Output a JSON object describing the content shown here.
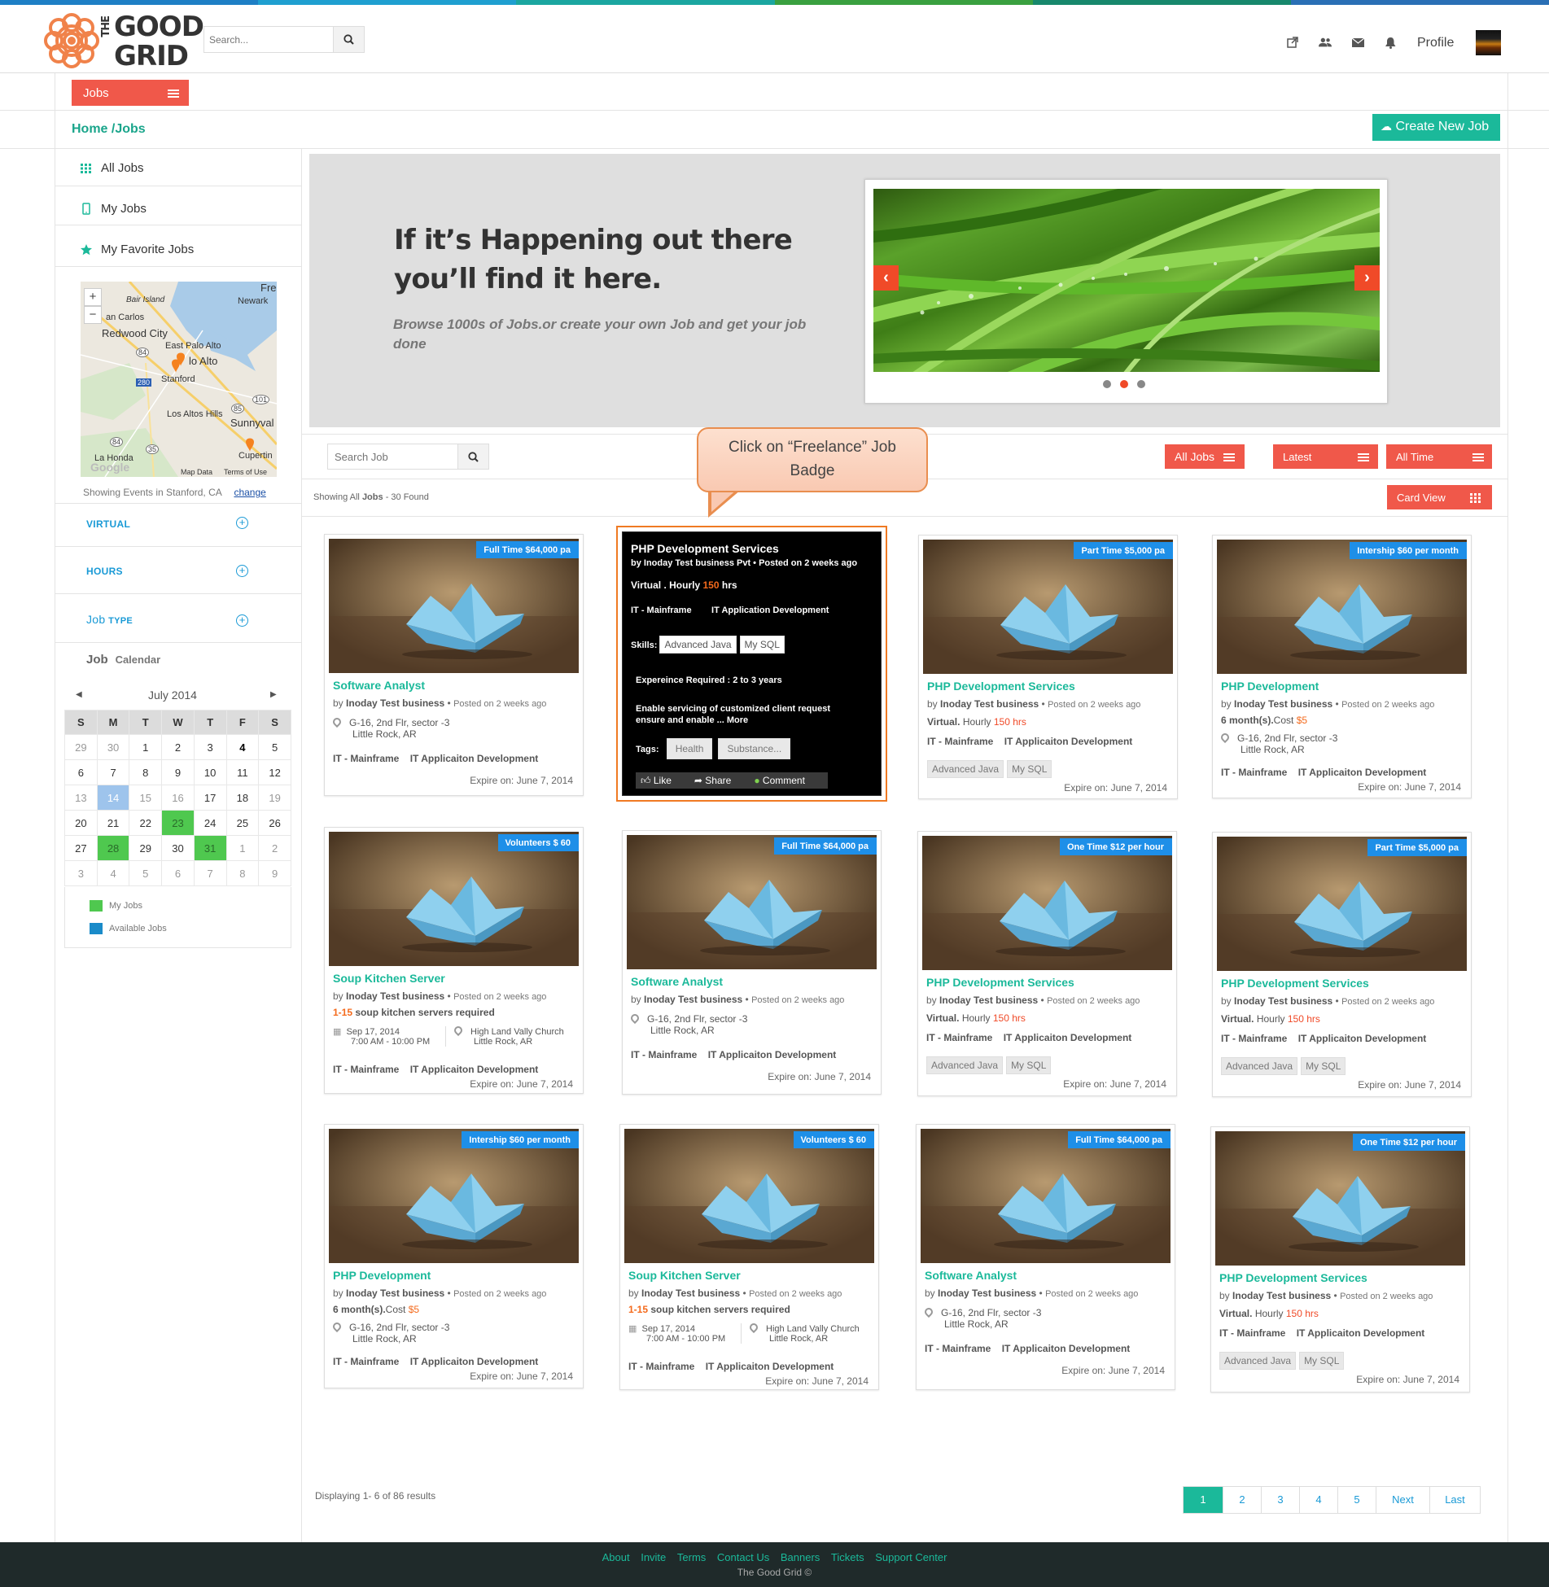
{
  "app": {
    "logo_text_line1": "THE GOOD",
    "logo_text_line2": "GRID",
    "logo_the": "THE",
    "logo_good": "GOOD",
    "search_placeholder": "Search...",
    "profile_label": "Profile",
    "header_icons": [
      "external-link-icon",
      "users-icon",
      "envelope-icon",
      "bell-icon"
    ]
  },
  "colors": {
    "accent": "#1bb99a",
    "primary_red": "#f0584a",
    "badge_blue": "#1e8fe8",
    "link_blue": "#1a9ad6",
    "calendar_green": "#4fc84f",
    "calendar_blue": "#9ec4ec",
    "footer_bg": "#1f2a2a"
  },
  "jobs_menu": {
    "label": "Jobs"
  },
  "breadcrumb": "Home /Jobs",
  "create_button": "Create New Job",
  "sidebar": {
    "items": [
      {
        "label": "All Jobs",
        "icon": "grid-icon"
      },
      {
        "label": "My Jobs",
        "icon": "mobile-icon"
      },
      {
        "label": "My Favorite Jobs",
        "icon": "star-icon"
      }
    ],
    "map": {
      "labels": [
        "Fre",
        "Bair Island",
        "Newark",
        "an Carlos",
        "Redwood City",
        "East Palo Alto",
        "lo Alto",
        "Stanford",
        "Los Altos Hills",
        "Sunnyval",
        "La Honda",
        "Cupertin",
        "Map Data",
        "Terms of Use"
      ],
      "road_labels": [
        "84",
        "280",
        "101",
        "85",
        "84",
        "35"
      ],
      "watermark": "Google",
      "zoom_in": "+",
      "zoom_out": "−"
    },
    "showing_events": "Showing Events in Stanford, CA",
    "change_link": "change",
    "filters": [
      {
        "label": "VIRTUAL"
      },
      {
        "label": "HOURS"
      },
      {
        "label_a": "Job",
        "label_b": "TYPE"
      }
    ],
    "calendar_header_a": "Job",
    "calendar_header_b": "Calendar",
    "calendar": {
      "month": "July 2014",
      "prev": "◀",
      "next": "▶",
      "weekdays": [
        "S",
        "M",
        "T",
        "W",
        "T",
        "F",
        "S"
      ],
      "weeks": [
        [
          "29",
          "30",
          "1",
          "2",
          "3",
          "4",
          "5"
        ],
        [
          "6",
          "7",
          "8",
          "9",
          "10",
          "11",
          "12"
        ],
        [
          "13",
          "14",
          "15",
          "16",
          "17",
          "18",
          "19"
        ],
        [
          "20",
          "21",
          "22",
          "23",
          "24",
          "25",
          "26"
        ],
        [
          "27",
          "28",
          "29",
          "30",
          "31",
          "1",
          "2"
        ],
        [
          "3",
          "4",
          "5",
          "6",
          "7",
          "8",
          "9"
        ]
      ]
    },
    "legend": [
      {
        "label": "My Jobs",
        "color": "#4fc84f"
      },
      {
        "label": "Available Jobs",
        "color": "#1a8bc9"
      }
    ]
  },
  "hero": {
    "headline_1": "If it’s Happening out there",
    "headline_2": "you’ll find it here.",
    "subtext": "Browse 1000s of Jobs.or create your own Job and get your job done"
  },
  "toolbar": {
    "search_placeholder": "Search Job",
    "filters": [
      "All Jobs",
      "Latest",
      "All Time"
    ],
    "view_button": "Card View",
    "showing_prefix": "Showing All",
    "showing_jobs": "Jobs",
    "showing_suffix": "- 30 Found"
  },
  "callout": {
    "line1": "Click on “Freelance” Job",
    "line2": "Badge"
  },
  "common": {
    "business": "Inoday Test business",
    "by": "by",
    "posted": "Posted on 2 weeks ago",
    "address_1": "G-16, 2nd Flr, sector -3",
    "address_2": "Little Rock, AR",
    "church_1": "High Land Vally Church",
    "church_2": "Little Rock, AR",
    "event_date": "Sep 17, 2014",
    "event_time": "7:00 AM - 10:00 PM",
    "cat_1": "IT - Mainframe",
    "cat_2": "IT Applicaiton Development",
    "expire": "Expire on: June 7, 2014",
    "skill_1": "Advanced Java",
    "skill_2": "My SQL",
    "virtual_label": "Virtual.",
    "hourly": "Hourly",
    "hours": "150 hrs",
    "months_label": "6 month(s).",
    "cost_label": "Cost",
    "cost_value": "$5",
    "servers_range": "1-15",
    "servers_text": "soup kitchen servers required"
  },
  "cards": [
    {
      "badge": "Full Time $64,000 pa",
      "title": "Software Analyst"
    },
    {
      "badge": "",
      "title": "PHP Development Services"
    },
    {
      "badge": "Part Time $5,000 pa",
      "title": "PHP Development Services"
    },
    {
      "badge": "Intership $60 per month",
      "title": "PHP Development"
    },
    {
      "badge": "Volunteers  $ 60",
      "title": "Soup Kitchen Server"
    },
    {
      "badge": "Full Time $64,000 pa",
      "title": "Software Analyst"
    },
    {
      "badge": "One Time $12 per hour",
      "title": "PHP Development Services"
    },
    {
      "badge": "Part Time $5,000 pa",
      "title": "PHP Development Services"
    },
    {
      "badge": "Intership $60 per month",
      "title": "PHP Development"
    },
    {
      "badge": "Volunteers  $ 60",
      "title": "Soup Kitchen Server"
    },
    {
      "badge": "Full Time $64,000 pa",
      "title": "Software Analyst"
    },
    {
      "badge": "One Time $12 per hour",
      "title": "PHP Development Services"
    }
  ],
  "dark_card": {
    "title": "PHP Development Services",
    "by_line": "by Inoday Test business Pvt •  Posted on 2 weeks ago",
    "virtual_line_a": "Virtual . Hourly",
    "virtual_line_b": "150",
    "virtual_line_c": "hrs",
    "categories": "IT - Mainframe        IT Application Development",
    "skills_label": "Skills:",
    "skills": [
      "Advanced Java",
      "My SQL"
    ],
    "experience": "Expereince Required :  2 to 3 years",
    "description": "Enable servicing of customized client request ensure and enable ... More",
    "tags_label": "Tags:",
    "tags": [
      "Health",
      "Substance..."
    ],
    "actions": [
      "Like",
      "Share",
      "Comment"
    ]
  },
  "pagination": {
    "displaying": "Displaying  1- 6 of  86 results",
    "pages": [
      "1",
      "2",
      "3",
      "4",
      "5",
      "Next",
      "Last"
    ]
  },
  "footer": {
    "links": [
      "About",
      "Invite",
      "Terms",
      "Contact Us",
      "Banners",
      "Tickets",
      "Support Center"
    ],
    "copyright": "The Good Grid ©"
  }
}
